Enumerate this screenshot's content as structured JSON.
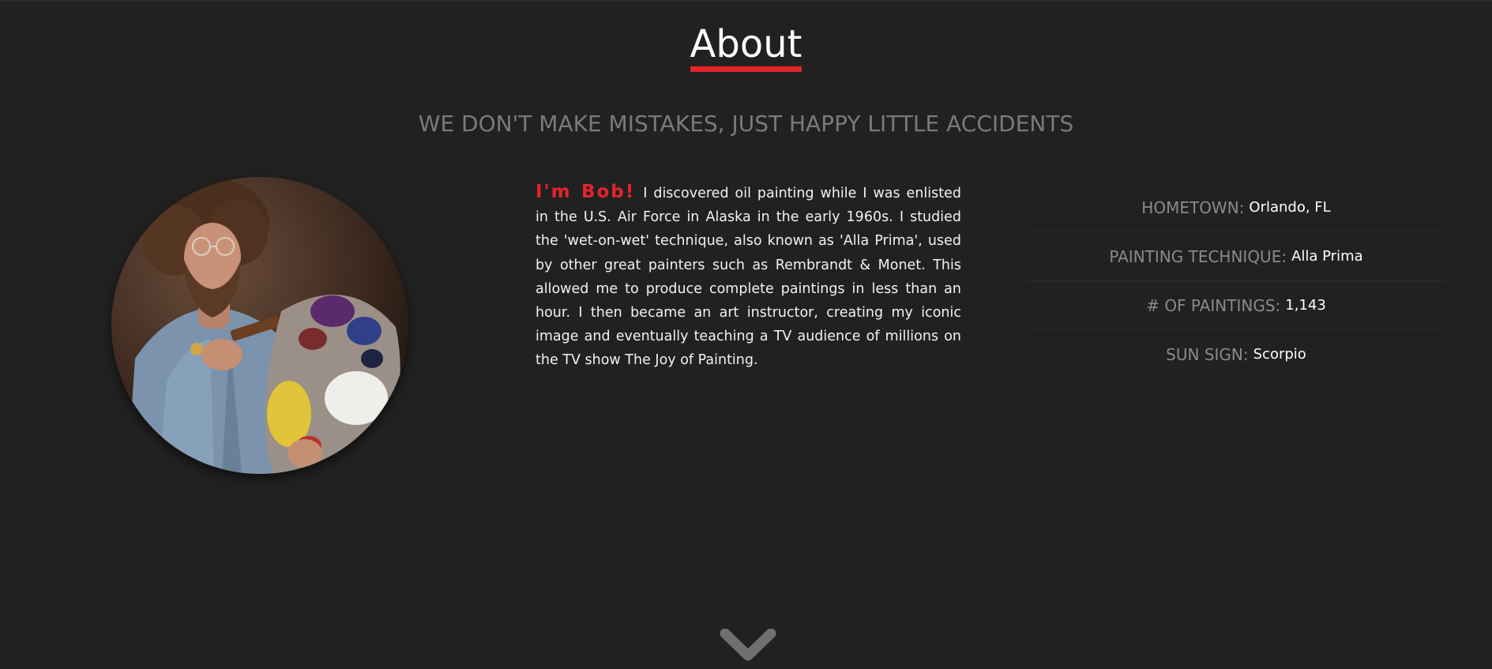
{
  "section": {
    "title": "About",
    "tagline": "WE DON'T MAKE MISTAKES, JUST HAPPY LITTLE ACCIDENTS"
  },
  "bio": {
    "greeting": "I'm Bob!",
    "text": "I discovered oil painting while I was enlisted in the U.S. Air Force in Alaska in the early 1960s. I studied the 'wet-on-wet' technique, also known as 'Alla Prima', used by other great painters such as Rembrandt & Monet. This allowed me to produce complete paintings in less than an hour. I then became an art instructor, creating my iconic image and eventually teaching a TV audience of millions on the TV show The Joy of Painting."
  },
  "facts": [
    {
      "label": "HOMETOWN:",
      "value": "Orlando, FL"
    },
    {
      "label": "PAINTING TECHNIQUE:",
      "value": "Alla Prima"
    },
    {
      "label": "# OF PAINTINGS:",
      "value": "1,143"
    },
    {
      "label": "SUN SIGN:",
      "value": "Scorpio"
    }
  ],
  "icons": {
    "scroll": "chevron-down-icon",
    "portrait": "portrait-photo"
  },
  "colors": {
    "background": "#212121",
    "accent": "#e5242b",
    "muted_text": "#7a7a7a",
    "body_text": "#f2f2f2"
  }
}
